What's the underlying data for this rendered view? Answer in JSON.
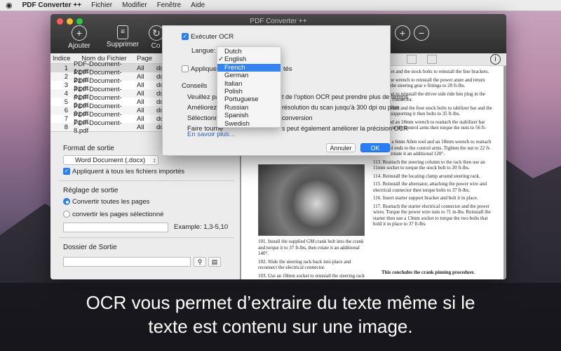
{
  "menubar": {
    "app": "PDF Converter ++",
    "items": [
      "Fichier",
      "Modifier",
      "Fenêtre",
      "Aide"
    ]
  },
  "window": {
    "title": "PDF Converter ++"
  },
  "toolbar": {
    "add_label": "Ajouter",
    "delete_label": "Supprimer",
    "convert_label": "Co"
  },
  "table": {
    "headers": [
      "Indice",
      "Nom du Fichier",
      "Page",
      ""
    ],
    "rows": [
      {
        "index": "1",
        "name": "PDF-Document-1.pdf",
        "page": "All",
        "type": "doc"
      },
      {
        "index": "2",
        "name": "PDF-Document-2.pdf",
        "page": "All",
        "type": "doc"
      },
      {
        "index": "3",
        "name": "PDF-Document-3.pdf",
        "page": "All",
        "type": "doc"
      },
      {
        "index": "4",
        "name": "PDF-Document-4.pdf",
        "page": "All",
        "type": "doc"
      },
      {
        "index": "5",
        "name": "PDF-Document-5.pdf",
        "page": "All",
        "type": "doc"
      },
      {
        "index": "6",
        "name": "PDF-Document-6.pdf",
        "page": "All",
        "type": "doc"
      },
      {
        "index": "7",
        "name": "PDF-Document-7.pdf",
        "page": "All",
        "type": "doc"
      },
      {
        "index": "8",
        "name": "PDF-Document-8.pdf",
        "page": "All",
        "type": "doc"
      }
    ]
  },
  "output": {
    "format_title": "Format de sortie",
    "format_value": "Word Document (.docx)",
    "apply_all": "Appliquent à tous les fichiers importés",
    "settings_title": "Réglage de sortie",
    "convert_all": "Convertir toutes les pages",
    "convert_selected": "convertir les pages sélectionné",
    "example": "Example: 1,3-5,10",
    "folder_title": "Dossier de Sortie"
  },
  "dialog": {
    "ocr_label": "Exécuter OCR",
    "language_label": "Langue:",
    "apply_prefix": "Appliquer",
    "apply_suffix": "tés",
    "tips_title": "Conseils",
    "tips": [
      {
        "left": "Veuillez pati",
        "right": "t de l'option OCR peut prendre plus de temps"
      },
      {
        "left": "Améliorez la",
        "right": "résolution du scan jusqu'à 300 dpi ou plus"
      },
      {
        "left": "Sélectionne",
        "right": "conversion"
      },
      {
        "left": "Faire tourne",
        "right": "s peut également améliorer la précision OCR"
      }
    ],
    "more_link": "En savoir plus…",
    "cancel": "Annuler",
    "ok": "OK"
  },
  "language_menu": {
    "options": [
      "Dutch",
      "English",
      "French",
      "German",
      "Italian",
      "Polish",
      "Portuguese",
      "Russian",
      "Spanish",
      "Swedish"
    ],
    "checked": "English",
    "highlighted": "French"
  },
  "preview": {
    "left_col": [
      "101. Install the supplied GM crank bolt into the crank and torque it to 37 ft-lbs, then rotate it an additional 140°.",
      "102. Slide the steering rack back into place and reconnect the electrical connector.",
      "103. Use an 18mm socket to reinstall the steering rack nuts and bolts then torque them to 74 ft-lbs.",
      "104. Reinstall the front crossmember nuts then use a utility jack to lift the crossmember. Torque all four crossmember bolts to 100 ft-lbs."
    ],
    "right_col": [
      "mm socket and the stock bolts to reinstall the line brackets.",
      "18mm line wrench to reinstall the power ature and return hoses to the steering gear e fittings to 20 ft-lbs.",
      "mm socket to reinstall the driver side ride hen plug in the electrical connector.",
      "13mm socket and the four stock bolts to tabilizer bar and the brackets supporting it then bolts to 35 ft-lbs.",
      "18mm and an 18mm wrench to reattach the stabilizer bar end links to the control arms then torque the nuts to 56 ft-lbs.",
      "112. Use a 6mm Allen tool and an 18mm wrench to reattach the tie rod ends to the control arms. Tighten the nut to 22 ft-lbs. then rotate it an additional 120°.",
      "113. Reattach the steering column to the rack then use an 11mm socket to torque the stock bolt to 20 ft-lbs.",
      "114. Reinstall the locating clamp around steering rack.",
      "115. Reinstall the alternator, attaching the power wire and electrical connector then torque bolts to 37 ft-lbs.",
      "116. Insert starter support bracket and bolt it in place.",
      "117. Reattach the starter electrical connector and the power wires. Torque the power wire nuts to 71 in-lbs. Reinstall the starter then use a 13mm socket to torque the two bolts that hold it in place to 37 ft-lbs."
    ],
    "concluding": "This concludes the crank pinning procedure."
  },
  "caption": {
    "line1": "OCR vous permet d’extraire du texte même si le",
    "line2": "texte est contenu sur une image."
  },
  "colors": {
    "accent": "#2a7ef5",
    "toolbar": "#3a3a3a"
  }
}
